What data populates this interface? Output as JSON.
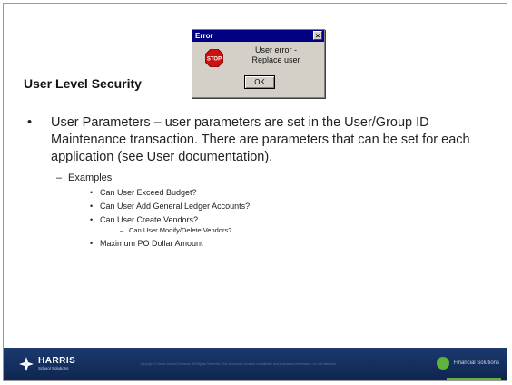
{
  "slide": {
    "title": "User Level Security"
  },
  "dialog": {
    "title": "Error",
    "close": "×",
    "message_line1": "User error -",
    "message_line2": "Replace user",
    "ok_label": "OK",
    "stop_text": "STOP"
  },
  "content": {
    "bullet_char": "•",
    "dash_char": "–",
    "main_text": "User Parameters – user parameters are set in the User/Group ID Maintenance transaction.  There are parameters that can be set for each application (see User documentation).",
    "examples_label": "Examples",
    "items": [
      "Can User Exceed Budget?",
      "Can User Add General Ledger Accounts?",
      "Can User Create Vendors?"
    ],
    "sub_item": "Can User Modify/Delete Vendors?",
    "last_item": "Maximum PO Dollar Amount"
  },
  "footer": {
    "logo_name": "HARRIS",
    "logo_sub": "School Solutions",
    "copyright": "Copyright © Harris School Solutions. All Rights Reserved. This document contains confidential and proprietary information. Do not distribute.",
    "partner": "Financial Solutions"
  },
  "colors": {
    "footer_bg": "#1c3a6e",
    "accent_green": "#5fb23c",
    "dialog_title": "#000080",
    "stop_red": "#cc1111"
  }
}
